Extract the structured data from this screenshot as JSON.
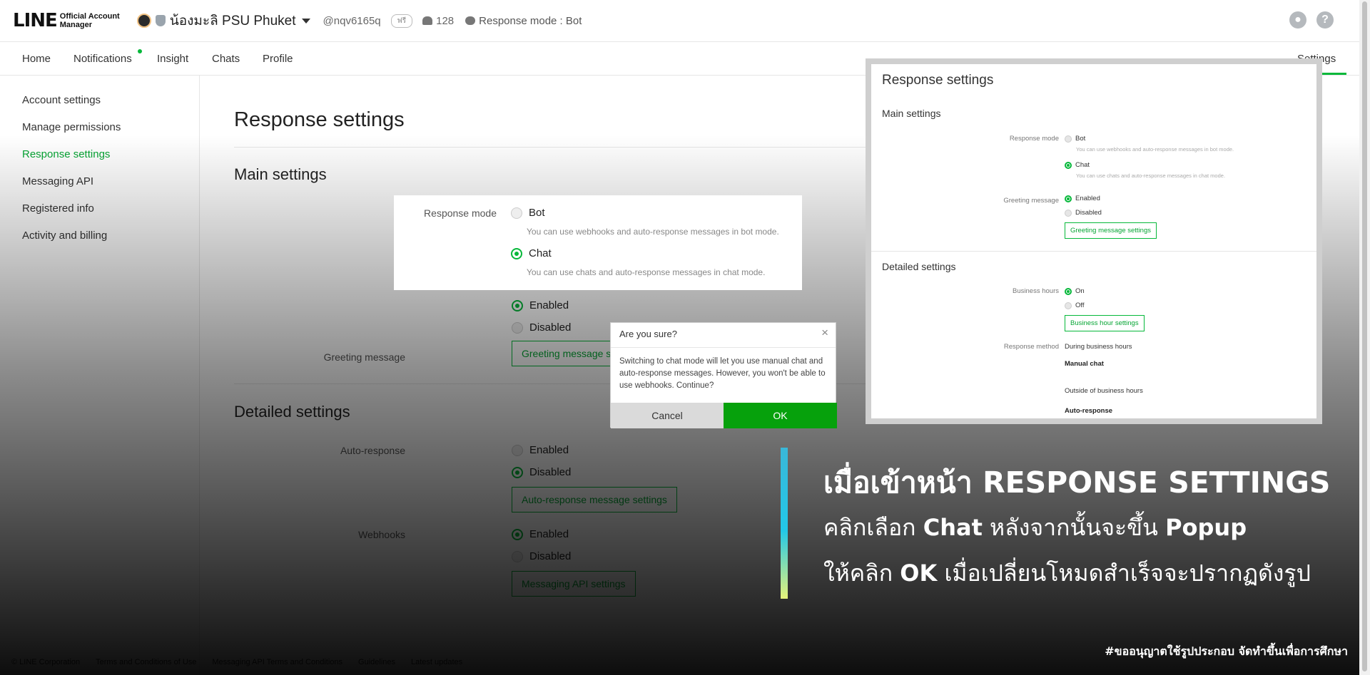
{
  "header": {
    "logo": "LINE",
    "logo_sub_1": "Official Account",
    "logo_sub_2": "Manager",
    "account_name": "น้องมะลิ PSU Phuket",
    "account_id": "@nqv6165q",
    "plan_badge": "ฟรี",
    "friends_count": "128",
    "response_mode": "Response mode : Bot"
  },
  "nav": {
    "items": [
      "Home",
      "Notifications",
      "Insight",
      "Chats",
      "Profile"
    ],
    "settings": "Settings"
  },
  "sidebar": {
    "items": [
      "Account settings",
      "Manage permissions",
      "Response settings",
      "Messaging API",
      "Registered info",
      "Activity and billing"
    ],
    "active": "Response settings"
  },
  "main": {
    "title": "Response settings",
    "main_settings": "Main settings",
    "response_mode_label": "Response mode",
    "bot_label": "Bot",
    "bot_hint": "You can use webhooks and auto-response messages in bot mode.",
    "chat_label": "Chat",
    "chat_hint": "You can use chats and auto-response messages in chat mode.",
    "greeting_label": "Greeting message",
    "enabled": "Enabled",
    "disabled": "Disabled",
    "greeting_btn": "Greeting message settings",
    "detailed_settings": "Detailed settings",
    "auto_response_label": "Auto-response",
    "auto_response_btn": "Auto-response message settings",
    "webhooks_label": "Webhooks",
    "messaging_api_btn": "Messaging API settings"
  },
  "dialog": {
    "title": "Are you sure?",
    "close": "×",
    "body": "Switching to chat mode will let you use manual chat and auto-response messages. However, you won't be able to use webhooks. Continue?",
    "cancel": "Cancel",
    "ok": "OK"
  },
  "preview": {
    "title": "Response settings",
    "main_settings": "Main settings",
    "response_mode": "Response mode",
    "bot": "Bot",
    "bot_hint": "You can use webhooks and auto-response messages in bot mode.",
    "chat": "Chat",
    "chat_hint": "You can use chats and auto-response messages in chat mode.",
    "greeting": "Greeting message",
    "enabled": "Enabled",
    "disabled": "Disabled",
    "greeting_btn": "Greeting message settings",
    "detailed_settings": "Detailed settings",
    "business_hours": "Business hours",
    "on": "On",
    "off": "Off",
    "business_btn": "Business hour settings",
    "response_method": "Response method",
    "during": "During business hours",
    "manual_chat": "Manual chat",
    "outside": "Outside of business hours",
    "auto_response": "Auto-response"
  },
  "caption": {
    "line1": "เมื่อเข้าหน้า RESPONSE SETTINGS",
    "line2_a": "คลิกเลือก ",
    "line2_b": "Chat",
    "line2_c": " หลังจากนั้นจะขึ้น ",
    "line2_d": "Popup",
    "line3_a": "ให้คลิก ",
    "line3_b": "OK",
    "line3_c": " เมื่อเปลี่ยนโหมดสำเร็จจะปรากฏดังรูป",
    "credit": "#ขออนุญาตใช้รูปประกอบ จัดทำขึ้นเพื่อการศึกษา"
  },
  "footer": {
    "items": [
      "© LINE Corporation",
      "Terms and Conditions of Use",
      "Messaging API Terms and Conditions",
      "Guidelines",
      "Latest updates"
    ]
  },
  "colors": {
    "accent": "#06b83a",
    "ok_button": "#06a10c"
  }
}
